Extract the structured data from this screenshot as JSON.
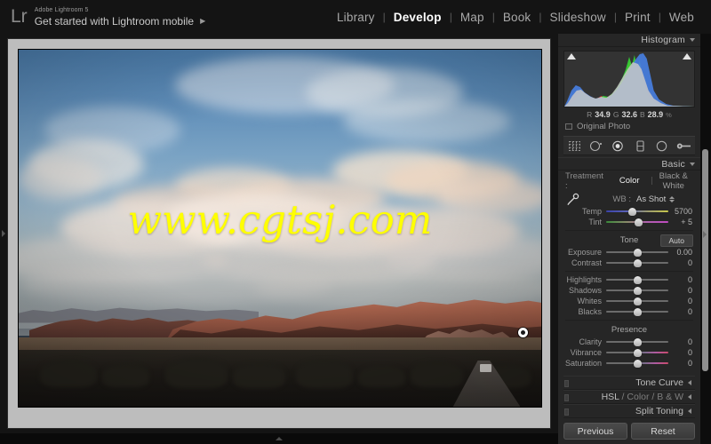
{
  "header": {
    "logo": "Lr",
    "product": "Adobe Lightroom 5",
    "tagline": "Get started with Lightroom mobile",
    "arrow_icon": "triangle-right-icon",
    "modules": [
      {
        "label": "Library",
        "active": false
      },
      {
        "label": "Develop",
        "active": true
      },
      {
        "label": "Map",
        "active": false
      },
      {
        "label": "Book",
        "active": false
      },
      {
        "label": "Slideshow",
        "active": false
      },
      {
        "label": "Print",
        "active": false
      },
      {
        "label": "Web",
        "active": false
      }
    ],
    "separator": "|"
  },
  "photo": {
    "watermark": "www.cgtsj.com",
    "watermark_color": "#ffff00",
    "description": "Desert landscape at sunset with blue sky, warm-lit cumulus clouds, red rock mountains and dark foreground scrub"
  },
  "histogram": {
    "title": "Histogram",
    "collapse_icon": "chevron-down-icon",
    "clip_left_icon": "shadow-clipping-triangle-icon",
    "clip_right_icon": "highlight-clipping-triangle-icon",
    "readout": {
      "r_label": "R",
      "r_value": "34.9",
      "g_label": "G",
      "g_value": "32.6",
      "b_label": "B",
      "b_value": "28.9",
      "unit": "%"
    },
    "original_photo_label": "Original Photo"
  },
  "toolstrip": {
    "tools": [
      {
        "name": "crop-overlay-icon",
        "label": "Crop Overlay"
      },
      {
        "name": "spot-removal-icon",
        "label": "Spot Removal"
      },
      {
        "name": "red-eye-correction-icon",
        "label": "Red Eye Correction"
      },
      {
        "name": "graduated-filter-icon",
        "label": "Graduated Filter"
      },
      {
        "name": "radial-filter-icon",
        "label": "Radial Filter"
      },
      {
        "name": "adjustment-brush-icon",
        "label": "Adjustment Brush"
      }
    ]
  },
  "basic": {
    "title": "Basic",
    "collapse_icon": "chevron-down-icon",
    "treatment": {
      "label": "Treatment :",
      "options": [
        {
          "label": "Color",
          "active": true
        },
        {
          "label": "Black & White",
          "active": false
        }
      ]
    },
    "white_balance": {
      "eyedropper_icon": "eyedropper-icon",
      "label": "WB :",
      "value": "As Shot",
      "stepper_icon": "stepper-updown-icon",
      "sliders": [
        {
          "label": "Temp",
          "value": "5700",
          "pos": 42,
          "track": "temp"
        },
        {
          "label": "Tint",
          "value": "+ 5",
          "pos": 52,
          "track": "tint"
        }
      ]
    },
    "tone": {
      "title": "Tone",
      "auto_label": "Auto",
      "sliders_primary": [
        {
          "label": "Exposure",
          "value": "0.00",
          "pos": 50,
          "track": "plain"
        },
        {
          "label": "Contrast",
          "value": "0",
          "pos": 50,
          "track": "plain"
        }
      ],
      "sliders_secondary": [
        {
          "label": "Highlights",
          "value": "0",
          "pos": 50,
          "track": "plain"
        },
        {
          "label": "Shadows",
          "value": "0",
          "pos": 50,
          "track": "plain"
        },
        {
          "label": "Whites",
          "value": "0",
          "pos": 50,
          "track": "plain"
        },
        {
          "label": "Blacks",
          "value": "0",
          "pos": 50,
          "track": "plain"
        }
      ]
    },
    "presence": {
      "title": "Presence",
      "sliders": [
        {
          "label": "Clarity",
          "value": "0",
          "pos": 50,
          "track": "plain"
        },
        {
          "label": "Vibrance",
          "value": "0",
          "pos": 50,
          "track": "vib"
        },
        {
          "label": "Saturation",
          "value": "0",
          "pos": 50,
          "track": "sat"
        }
      ]
    }
  },
  "collapsed_panels": [
    {
      "title": "Tone Curve",
      "dim": "",
      "expand_icon": "triangle-left-icon"
    },
    {
      "title": "HSL",
      "dim": " /  Color  /  B & W",
      "expand_icon": "triangle-left-icon"
    },
    {
      "title": "Split Toning",
      "dim": "",
      "expand_icon": "triangle-left-icon"
    }
  ],
  "footer_buttons": [
    {
      "label": "Previous"
    },
    {
      "label": "Reset"
    }
  ],
  "toggles": {
    "left_panel_icon": "triangle-right-icon",
    "bottom_filmstrip_icon": "triangle-up-icon",
    "right_panel_icon": "triangle-right-icon"
  },
  "chart_data": {
    "type": "area",
    "title": "Histogram",
    "xlabel": "",
    "ylabel": "",
    "channels": [
      "Red",
      "Green",
      "Blue",
      "Luminance"
    ],
    "colors": {
      "red": "#ff2a2a",
      "green": "#2aff2a",
      "blue": "#2a6aff",
      "luminance": "#cfcfcf"
    },
    "readout": {
      "R": 34.9,
      "G": 32.6,
      "B": 28.9,
      "unit": "%"
    }
  }
}
